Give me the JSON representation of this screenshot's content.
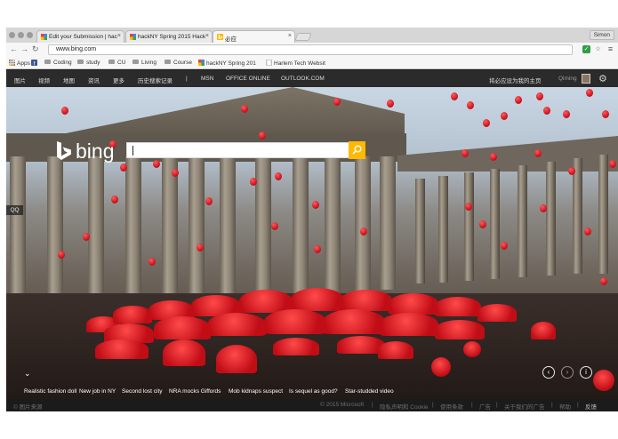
{
  "browser": {
    "tabs": [
      {
        "title": "Edit your Submission | hac",
        "active": false
      },
      {
        "title": "hackNY Spring 2015 Hack",
        "active": false
      },
      {
        "title": "必应",
        "active": true
      }
    ],
    "user": "Simon",
    "address": "www.bing.com",
    "colors": {
      "tab_strip": "#d6d6d6",
      "toolbar": "#f6f6f6"
    }
  },
  "bookmarks": [
    {
      "label": "Apps",
      "icon": "apps-grid-icon"
    },
    {
      "label": "",
      "icon": "facebook-icon"
    },
    {
      "label": "Coding",
      "icon": "folder-icon"
    },
    {
      "label": "study",
      "icon": "folder-icon"
    },
    {
      "label": "CU",
      "icon": "folder-icon"
    },
    {
      "label": "Living",
      "icon": "folder-icon"
    },
    {
      "label": "Course",
      "icon": "folder-icon"
    },
    {
      "label": "hackNY Spring 201",
      "icon": "hackny-icon"
    },
    {
      "label": "Harlem Tech Websit",
      "icon": "page-icon"
    }
  ],
  "bing": {
    "nav": [
      "图片",
      "视频",
      "地图",
      "资讯",
      "更多",
      "历史搜索记录",
      "|",
      "MSN",
      "OFFICE ONLINE",
      "OUTLOOK.COM"
    ],
    "right_text": "将必应设为我的主页",
    "user_name": "Qiming",
    "logo_text": "bing",
    "qq_label": "QQ",
    "news": [
      "Realistic fashion doll",
      "New job in NY",
      "Second lost city",
      "NRA mocks Giffords",
      "Mob kidnaps suspect",
      "Is sequel as good?",
      "Star-studded video"
    ],
    "footer_left": "© 图片来源",
    "footer_right": [
      "© 2015 Microsoft",
      "|",
      "隐私声明和 Cookie",
      "|",
      "使用条款",
      "|",
      "广告",
      "|",
      "关于我们的广告",
      "|",
      "帮助",
      "|",
      "反馈"
    ],
    "colors": {
      "search_button": "#ffb900",
      "header": "#2b2b2b",
      "footer": "#1b1b1b"
    }
  }
}
